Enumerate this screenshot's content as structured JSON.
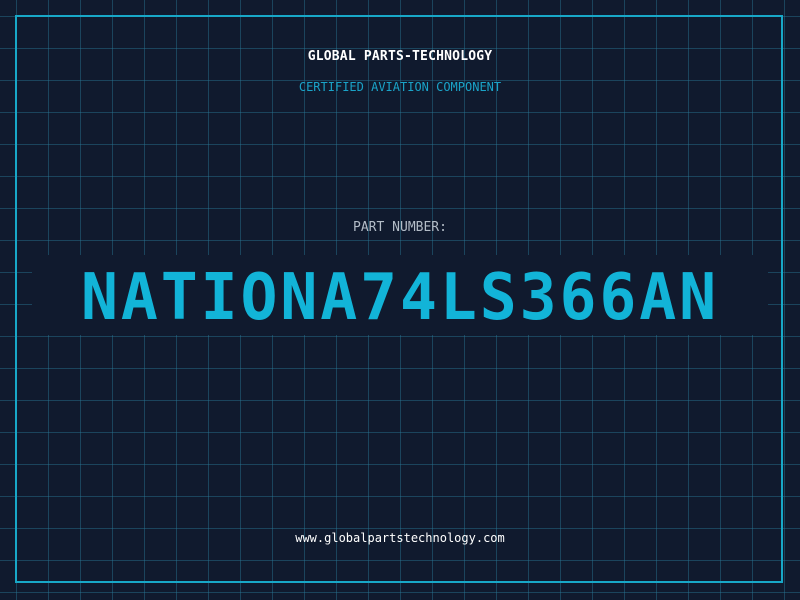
{
  "header": {
    "company": "GLOBAL PARTS-TECHNOLOGY",
    "tagline": "CERTIFIED AVIATION COMPONENT"
  },
  "part": {
    "label": "PART NUMBER:",
    "number": "NATIONA74LS366AN"
  },
  "footer": {
    "website": "www.globalpartstechnology.com"
  },
  "colors": {
    "background": "#101a2e",
    "grid": "#28789a",
    "accent": "#12b4d8",
    "frame": "#18a8c8",
    "text_primary": "#ffffff",
    "text_muted": "#b3bcc7"
  }
}
